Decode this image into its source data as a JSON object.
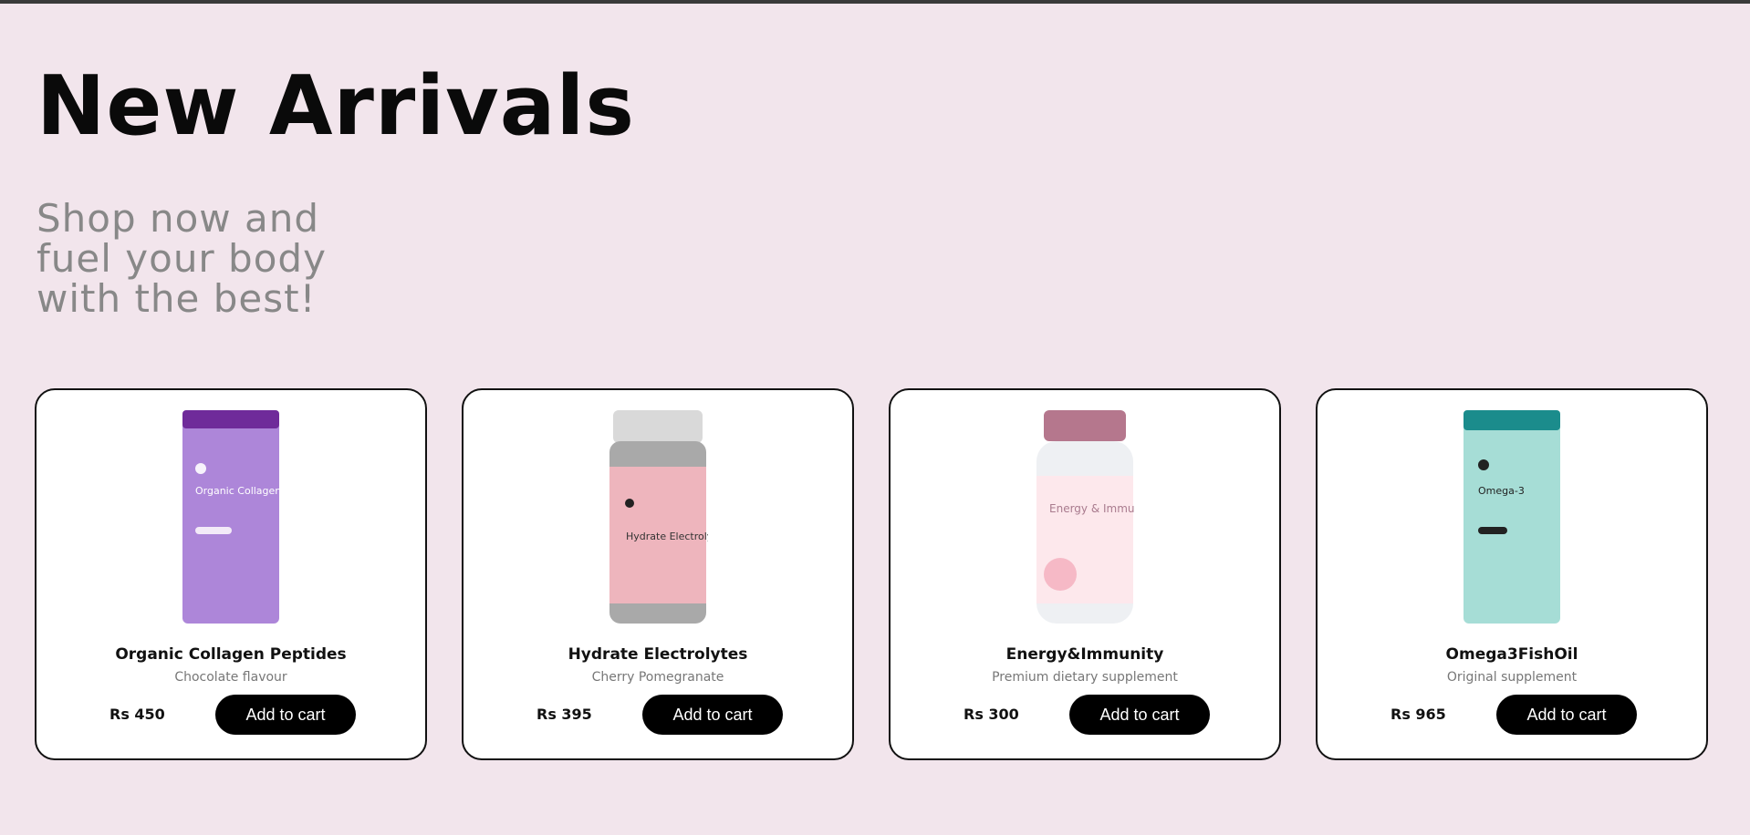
{
  "header": {
    "title": "New Arrivals",
    "subtitle": "Shop now and fuel your body with the best!"
  },
  "products": [
    {
      "name": "Organic Collagen Peptides",
      "subtitle": "Chocolate flavour",
      "price": "Rs 450",
      "button_label": "Add to cart",
      "image_label": "Organic Collagen Peptides",
      "color": "#a77fd6"
    },
    {
      "name": "Hydrate Electrolytes",
      "subtitle": "Cherry Pomegranate",
      "price": "Rs 395",
      "button_label": "Add to cart",
      "image_label": "Hydrate Electrolytes",
      "color": "#efb7c0"
    },
    {
      "name": "Energy&Immunity",
      "subtitle": "Premium dietary supplement",
      "price": "Rs 300",
      "button_label": "Add to cart",
      "image_label": "Energy & Immunity",
      "color": "#f7c7d1"
    },
    {
      "name": "Omega3FishOil",
      "subtitle": "Original supplement",
      "price": "Rs 965",
      "button_label": "Add to cart",
      "image_label": "Omega-3",
      "color": "#9fdad2"
    }
  ]
}
